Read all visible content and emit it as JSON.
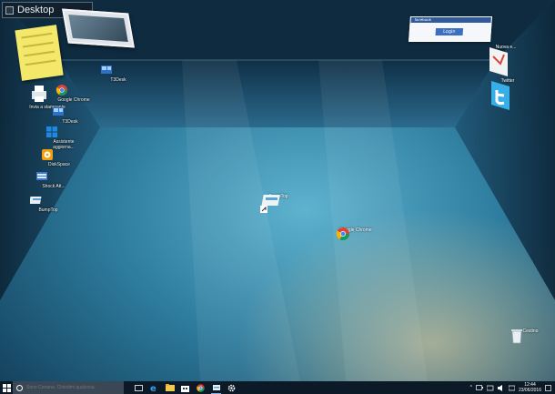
{
  "window_title": "Desktop",
  "login_widget": {
    "header": "facebook",
    "button_label": "Login"
  },
  "desktop_icons": {
    "t3desk_top": "T3Desk",
    "invia_stampante": "Invia a stampante",
    "google_chrome_left": "Google Chrome",
    "t3desk_left": "T3Desk",
    "assistente": "Assistente aggiorna...",
    "diskspace": "DiskSpace",
    "shock_att": "Shock Att...",
    "bumptop_left": "BumpTop",
    "bumptop_center": "BumpTop",
    "google_chrome_center": "Google Chrome",
    "nuovo_email": "Nuova e...",
    "twitter": "Twitter",
    "cestino": "Cestino"
  },
  "taskbar": {
    "search_placeholder": "Sono Cortana. Chiedimi qualcosa.",
    "time": "12:44",
    "date": "23/06/2016"
  },
  "colors": {
    "floor": "#2f7a9a",
    "wall": "#1a4a66",
    "taskbar": "#0b1a26",
    "accent": "#7fb3e6"
  }
}
